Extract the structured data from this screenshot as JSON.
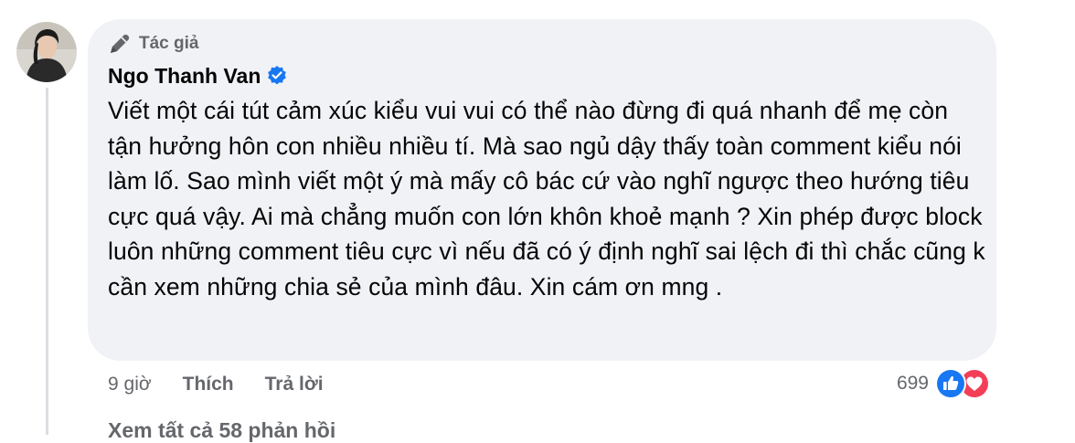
{
  "comment": {
    "badge_label": "Tác giả",
    "author_name": "Ngo Thanh Van",
    "text": "Viết một cái tút cảm xúc kiểu vui vui có thể nào đừng đi quá nhanh để mẹ còn tận hưởng hôn con nhiều nhiều tí. Mà sao ngủ dậy thấy toàn comment kiểu nói làm lố. Sao mình viết một ý mà mấy cô bác cứ vào nghĩ ngược theo hướng tiêu cực quá vậy. Ai mà chẳng muốn con lớn khôn khoẻ mạnh ? Xin phép được block luôn những comment tiêu cực vì nếu đã có ý định nghĩ sai lệch đi thì chắc cũng k cần xem những chia sẻ của mình đâu. Xin cám ơn mng .",
    "time": "9 giờ",
    "like_label": "Thích",
    "reply_label": "Trả lời",
    "reaction_count": "699",
    "reactions": [
      "like-icon",
      "love-icon"
    ],
    "view_replies_label": "Xem tất cả 58 phản hồi"
  },
  "colors": {
    "bubble": "#f0f2f5",
    "secondary_text": "#65676b",
    "like_blue": "#1877f2",
    "love_red": "#f33e58",
    "verified_blue": "#1877f2"
  }
}
